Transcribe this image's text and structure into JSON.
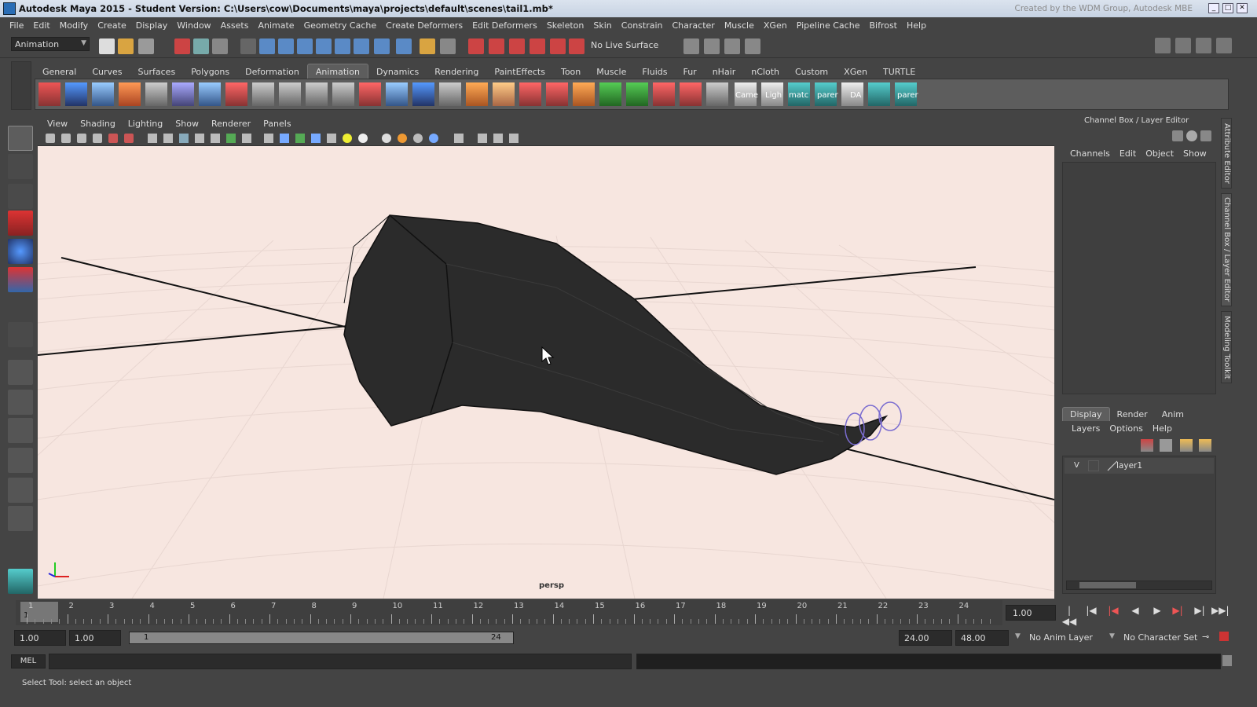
{
  "window": {
    "title": "Autodesk Maya 2015 - Student Version: C:\\Users\\cow\\Documents\\maya\\projects\\default\\scenes\\tail1.mb*",
    "credit": "Created by the WDM Group, Autodesk MBE"
  },
  "main_menu": [
    "File",
    "Edit",
    "Modify",
    "Create",
    "Display",
    "Window",
    "Assets",
    "Animate",
    "Geometry Cache",
    "Create Deformers",
    "Edit Deformers",
    "Skeleton",
    "Skin",
    "Constrain",
    "Character",
    "Muscle",
    "XGen",
    "Pipeline Cache",
    "Bifrost",
    "Help"
  ],
  "status_line": {
    "menu_set": "Animation",
    "live_surface": "No Live Surface"
  },
  "shelf": {
    "tabs": [
      "General",
      "Curves",
      "Surfaces",
      "Polygons",
      "Deformation",
      "Animation",
      "Dynamics",
      "Rendering",
      "PaintEffects",
      "Toon",
      "Muscle",
      "Fluids",
      "Fur",
      "nHair",
      "nCloth",
      "Custom",
      "XGen",
      "TURTLE"
    ],
    "active_tab": "Animation",
    "labels": [
      "Came",
      "Ligh",
      "matc",
      "parer",
      "DA",
      "parer"
    ]
  },
  "panel_menu": [
    "View",
    "Shading",
    "Lighting",
    "Show",
    "Renderer",
    "Panels"
  ],
  "viewport": {
    "camera": "persp"
  },
  "channel_box": {
    "title": "Channel Box / Layer Editor",
    "menu": [
      "Channels",
      "Edit",
      "Object",
      "Show"
    ]
  },
  "side_tabs": [
    "Attribute Editor",
    "Channel Box / Layer Editor",
    "Modeling Toolkit"
  ],
  "layer_editor": {
    "tabs": [
      "Display",
      "Render",
      "Anim"
    ],
    "active_tab": "Display",
    "menu": [
      "Layers",
      "Options",
      "Help"
    ],
    "layers": [
      {
        "visible": "V",
        "name": "layer1"
      }
    ]
  },
  "time_slider": {
    "ticks": [
      "1",
      "2",
      "3",
      "4",
      "5",
      "6",
      "7",
      "8",
      "9",
      "10",
      "11",
      "12",
      "13",
      "14",
      "15",
      "16",
      "17",
      "18",
      "19",
      "20",
      "21",
      "22",
      "23",
      "24"
    ],
    "current_frame_marker": "1",
    "current_time": "1.00"
  },
  "range_slider": {
    "start_time": "1.00",
    "playback_start": "1.00",
    "range_start_label": "1",
    "range_end_label": "24",
    "playback_end": "24.00",
    "end_time": "48.00",
    "anim_layer": "No Anim Layer",
    "character_set": "No Character Set"
  },
  "command_line": {
    "label": "MEL"
  },
  "help_line": {
    "text": "Select Tool: select an object"
  },
  "colors": {
    "viewport_bg": "#f7e6e0",
    "ui_bg": "#444444",
    "shelf_bg": "#5d5d5d"
  }
}
